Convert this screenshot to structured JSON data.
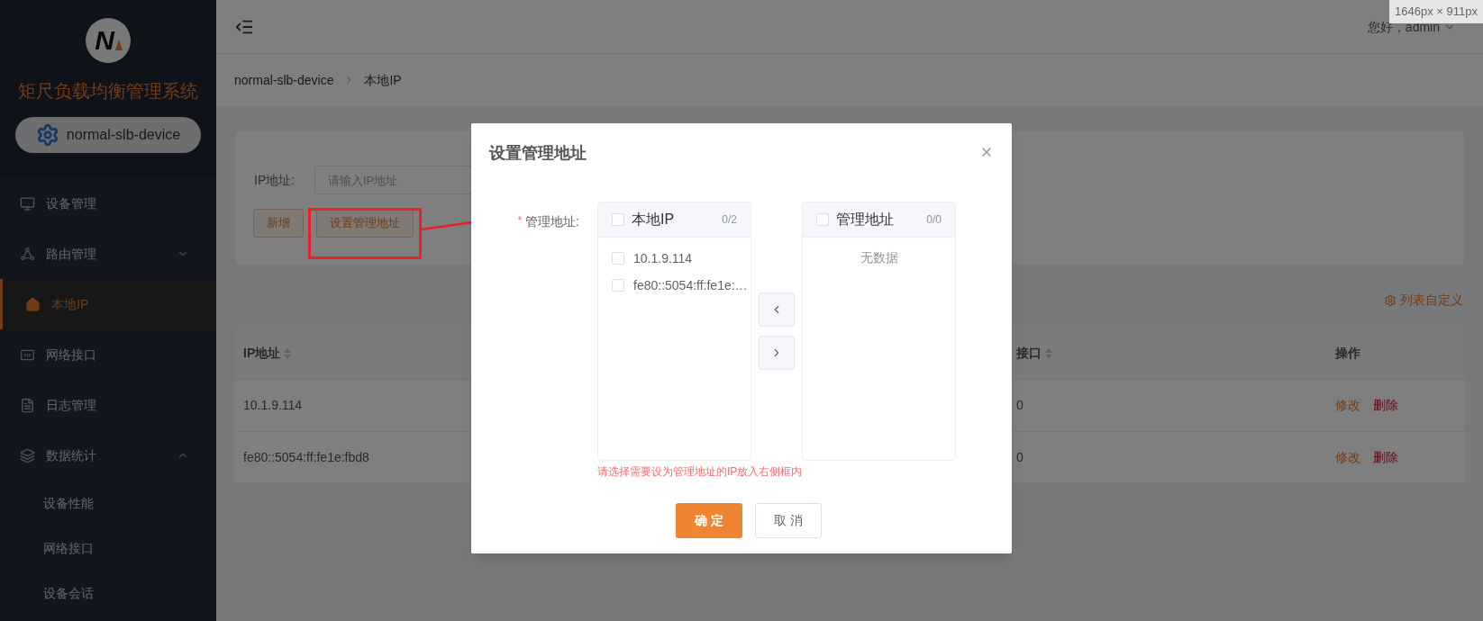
{
  "ruler_tooltip": "1646px × 911px",
  "sidebar": {
    "logo_text": "N",
    "system_title": "矩尺负载均衡管理系统",
    "device": "normal-slb-device",
    "items": [
      {
        "kind": "item",
        "label": "设备管理",
        "selected": false
      },
      {
        "kind": "group",
        "label": "路由管理",
        "selected": false,
        "expanded": false
      },
      {
        "kind": "item",
        "label": "本地IP",
        "selected": true
      },
      {
        "kind": "item",
        "label": "网络接口",
        "selected": false
      },
      {
        "kind": "item",
        "label": "日志管理",
        "selected": false
      },
      {
        "kind": "group",
        "label": "数据统计",
        "selected": false,
        "expanded": true,
        "children": [
          {
            "label": "设备性能",
            "selected": false
          },
          {
            "label": "网络接口",
            "selected": false
          },
          {
            "label": "设备会话",
            "selected": false
          }
        ]
      }
    ]
  },
  "header": {
    "user_menu": "您好，admin"
  },
  "breadcrumb": [
    "normal-slb-device",
    "本地IP"
  ],
  "filter": {
    "label": "IP地址:",
    "placeholder": "请输入IP地址",
    "buttons": [
      "新增",
      "设置管理地址"
    ]
  },
  "column_settings": "列表自定义",
  "table": {
    "columns": [
      {
        "label": "IP地址",
        "sortable": true
      },
      {
        "label": "接口",
        "sortable": true
      },
      {
        "label": "操作",
        "sortable": false
      }
    ],
    "rows": [
      {
        "ip": "10.1.9.114",
        "column_2": "0",
        "actions": [
          "修改",
          "删除"
        ]
      },
      {
        "ip": "fe80::5054:ff:fe1e:fbd8",
        "column_2": "0",
        "actions": [
          "修改",
          "删除"
        ]
      }
    ]
  },
  "dialog": {
    "title": "设置管理地址",
    "field_label": "管理地址:",
    "required_mark": "*",
    "source": {
      "title": "本地IP",
      "count": "0/2",
      "checked": false,
      "items": [
        {
          "label": "10.1.9.114",
          "checked": false
        },
        {
          "label": "fe80::5054:ff:fe1e:…",
          "checked": false
        }
      ]
    },
    "target": {
      "title": "管理地址",
      "count": "0/0",
      "checked": false,
      "empty_text": "无数据"
    },
    "hint": "请选择需要设为管理地址的IP放入右侧框内",
    "buttons": [
      {
        "label": "确 定",
        "kind": "primary"
      },
      {
        "label": "取 消",
        "kind": "default"
      }
    ]
  }
}
